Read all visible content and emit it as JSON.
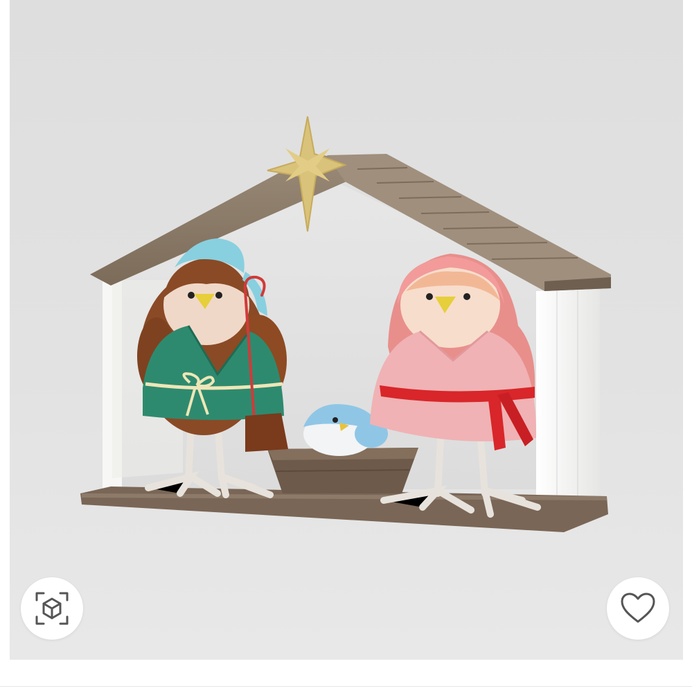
{
  "product_image": {
    "description_hidden": ""
  },
  "actions": {
    "view_in_3d_icon": "cube-scan-icon",
    "favorite_icon": "heart-outline-icon"
  },
  "colors": {
    "photo_background": "#e0e0e0",
    "roof_wood": "#8a7966",
    "wall_white": "#f4f4f2",
    "base_wood": "#7a6656",
    "star_gold": "#d9c27a",
    "shepherd_robe": "#2e8a6e",
    "mary_robe": "#f0b2b4",
    "sash_red": "#d8262a",
    "baby_blue": "#8fc6e6",
    "icon_stroke": "#555555"
  }
}
